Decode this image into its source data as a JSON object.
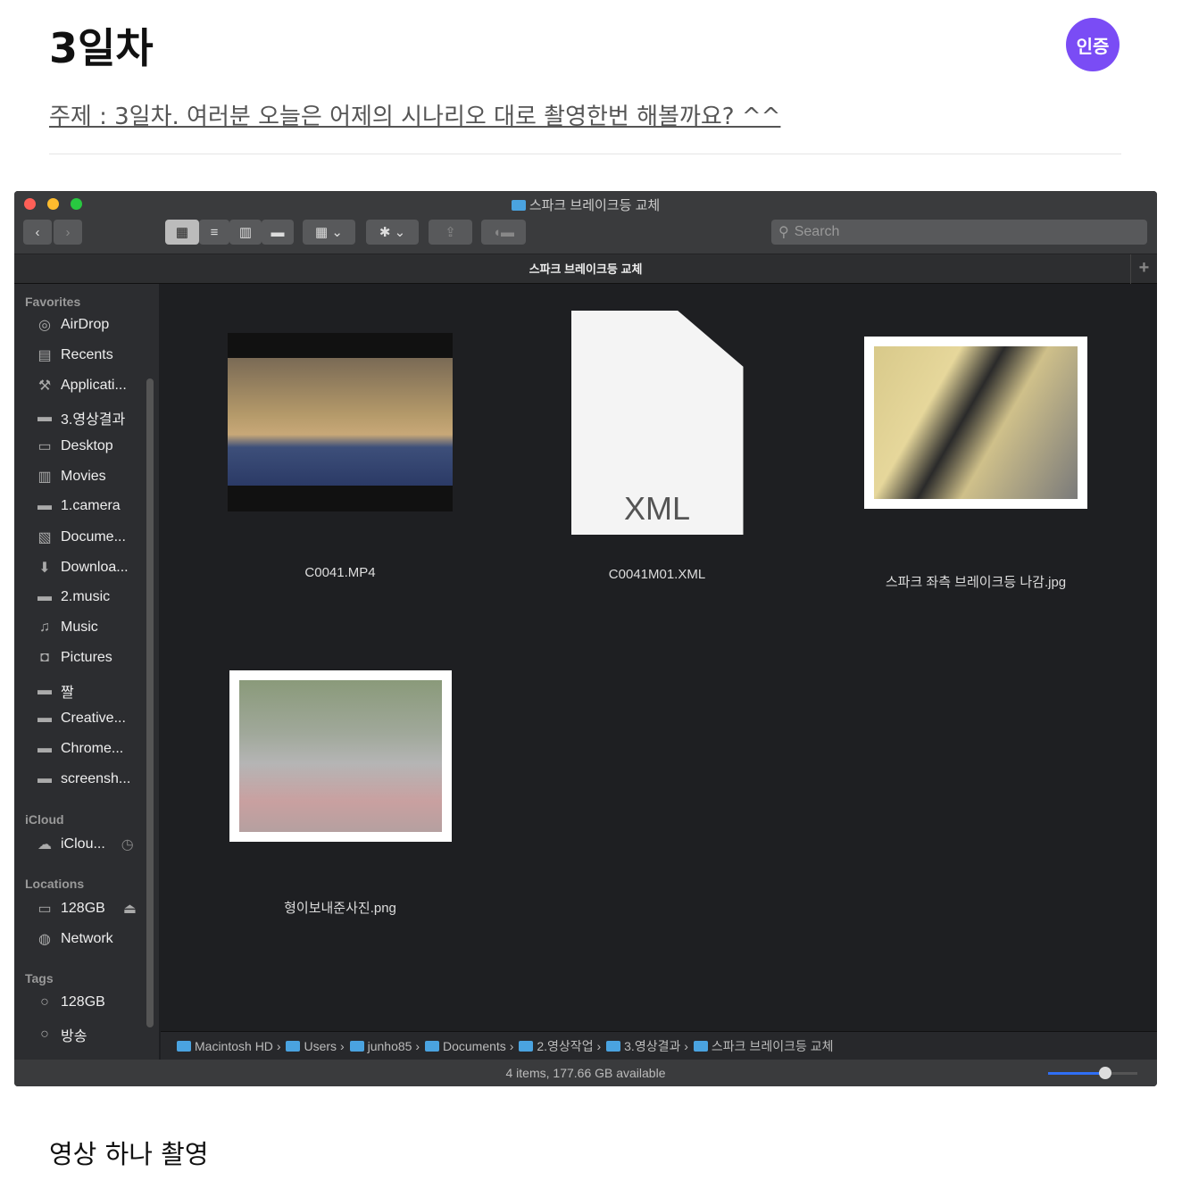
{
  "post": {
    "title": "3일차",
    "badge": "인증",
    "subject": "주제 : 3일차. 여러분 오늘은 어제의 시나리오 대로 촬영한번 해볼까요? ^^",
    "footer_text": "영상 하나 촬영"
  },
  "finder": {
    "window_title": "스파크 브레이크등 교체",
    "path_header": "스파크 브레이크등 교체",
    "search_placeholder": "Search",
    "sidebar": {
      "favorites_label": "Favorites",
      "favorites": [
        {
          "label": "AirDrop",
          "icon": "airdrop-icon"
        },
        {
          "label": "Recents",
          "icon": "recents-icon"
        },
        {
          "label": "Applicati...",
          "icon": "applications-icon"
        },
        {
          "label": "3.영상결과",
          "icon": "folder-icon"
        },
        {
          "label": "Desktop",
          "icon": "desktop-icon"
        },
        {
          "label": "Movies",
          "icon": "movies-icon"
        },
        {
          "label": "1.camera",
          "icon": "folder-icon"
        },
        {
          "label": "Docume...",
          "icon": "documents-icon"
        },
        {
          "label": "Downloa...",
          "icon": "downloads-icon"
        },
        {
          "label": "2.music",
          "icon": "folder-icon"
        },
        {
          "label": "Music",
          "icon": "music-icon"
        },
        {
          "label": "Pictures",
          "icon": "pictures-icon"
        },
        {
          "label": "짤",
          "icon": "folder-icon"
        },
        {
          "label": "Creative...",
          "icon": "folder-icon"
        },
        {
          "label": "Chrome...",
          "icon": "folder-icon"
        },
        {
          "label": "screensh...",
          "icon": "folder-icon"
        }
      ],
      "icloud_label": "iCloud",
      "icloud_item": "iClou...",
      "locations_label": "Locations",
      "locations": [
        "128GB",
        "Network"
      ],
      "tags_label": "Tags",
      "tags": [
        "128GB",
        "방송"
      ]
    },
    "files": [
      {
        "name": "C0041.MP4",
        "type": "video"
      },
      {
        "name": "C0041M01.XML",
        "type": "xml",
        "icon_text": "XML"
      },
      {
        "name": "스파크 좌측 브레이크등 나감.jpg",
        "type": "image"
      },
      {
        "name": "형이보내준사진.png",
        "type": "image"
      }
    ],
    "breadcrumb": [
      "Macintosh HD",
      "Users",
      "junho85",
      "Documents",
      "2.영상작업",
      "3.영상결과",
      "스파크 브레이크등 교체"
    ],
    "status": "4 items, 177.66 GB available",
    "icon_size_level": 0.64
  }
}
